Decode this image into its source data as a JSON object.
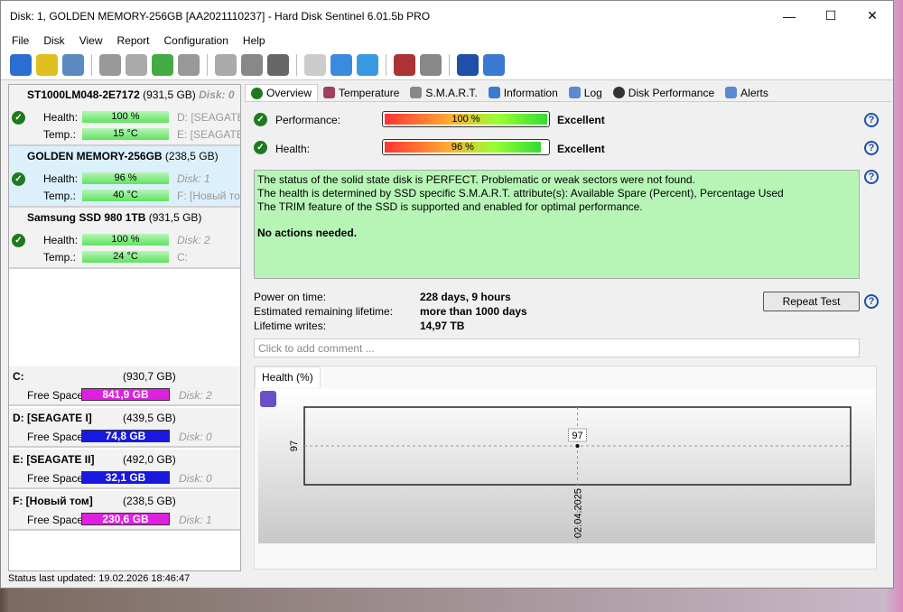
{
  "window": {
    "title": "Disk: 1, GOLDEN MEMORY-256GB [AA2021110237]  -  Hard Disk Sentinel 6.01.5b PRO"
  },
  "menu": [
    "File",
    "Disk",
    "View",
    "Report",
    "Configuration",
    "Help"
  ],
  "toolbar_icons": [
    "refresh-icon",
    "alert-icon",
    "disk-icon",
    "disk-gray-icon",
    "disk-test-icon",
    "disk-ok-icon",
    "disk-tool-icon",
    "head-icon",
    "drive-icon",
    "drive2-icon",
    "report-icon",
    "send-icon",
    "network-icon",
    "monitor-icon",
    "sound-icon",
    "help-icon",
    "info-icon"
  ],
  "disks": [
    {
      "name": "ST1000LM048-2E7172",
      "size": "(931,5 GB)",
      "disk": "Disk: 0",
      "health": "100 %",
      "temp": "15 °C",
      "side1": "D: [SEAGATE I]",
      "side2": "E: [SEAGATE II]",
      "selected": false
    },
    {
      "name": "GOLDEN MEMORY-256GB",
      "size": "(238,5 GB)",
      "disk": "",
      "health": "96 %",
      "temp": "40 °C",
      "side1": "Disk: 1",
      "side2": "F: [Новый том]",
      "selected": true
    },
    {
      "name": "Samsung SSD 980 1TB",
      "size": "(931,5 GB)",
      "disk": "",
      "health": "100 %",
      "temp": "24 °C",
      "side1": "Disk: 2",
      "side2": "C:",
      "selected": false
    }
  ],
  "labels": {
    "health": "Health:",
    "temp": "Temp.:",
    "free": "Free Space"
  },
  "volumes": [
    {
      "name": "C:",
      "size": "(930,7 GB)",
      "free": "841,9 GB",
      "disk": "Disk: 2",
      "color": "#e020e0"
    },
    {
      "name": "D: [SEAGATE I]",
      "size": "(439,5 GB)",
      "free": "74,8 GB",
      "disk": "Disk: 0",
      "color": "#1818e0"
    },
    {
      "name": "E: [SEAGATE II]",
      "size": "(492,0 GB)",
      "free": "32,1 GB",
      "disk": "Disk: 0",
      "color": "#1818e0"
    },
    {
      "name": "F: [Новый том]",
      "size": "(238,5 GB)",
      "free": "230,6 GB",
      "disk": "Disk: 1",
      "color": "#e020e0"
    }
  ],
  "status": "Status last updated: 19.02.2026 18:46:47",
  "tabs": [
    "Overview",
    "Temperature",
    "S.M.A.R.T.",
    "Information",
    "Log",
    "Disk Performance",
    "Alerts"
  ],
  "overview": {
    "performance_label": "Performance:",
    "performance_value": "100 %",
    "performance_pct": 100,
    "performance_rating": "Excellent",
    "health_label": "Health:",
    "health_value": "96 %",
    "health_pct": 96,
    "health_rating": "Excellent",
    "message": [
      "The status of the solid state disk is PERFECT. Problematic or weak sectors were not found.",
      "The health is determined by SSD specific S.M.A.R.T. attribute(s):  Available Spare (Percent), Percentage Used",
      "The TRIM feature of the SSD is supported and enabled for optimal performance."
    ],
    "actions": "No actions needed.",
    "power_on_label": "Power on time:",
    "power_on": "228 days, 9 hours",
    "remaining_label": "Estimated remaining lifetime:",
    "remaining": "more than 1000 days",
    "writes_label": "Lifetime writes:",
    "writes": "14,97 TB",
    "repeat_test": "Repeat Test",
    "comment_placeholder": "Click to add comment ..."
  },
  "chart_data": {
    "type": "line",
    "tab": "Health (%)",
    "x": [
      "02.04.2025"
    ],
    "values": [
      97
    ],
    "y_ticks": [
      "97"
    ],
    "point_label": "97",
    "grid": true
  }
}
